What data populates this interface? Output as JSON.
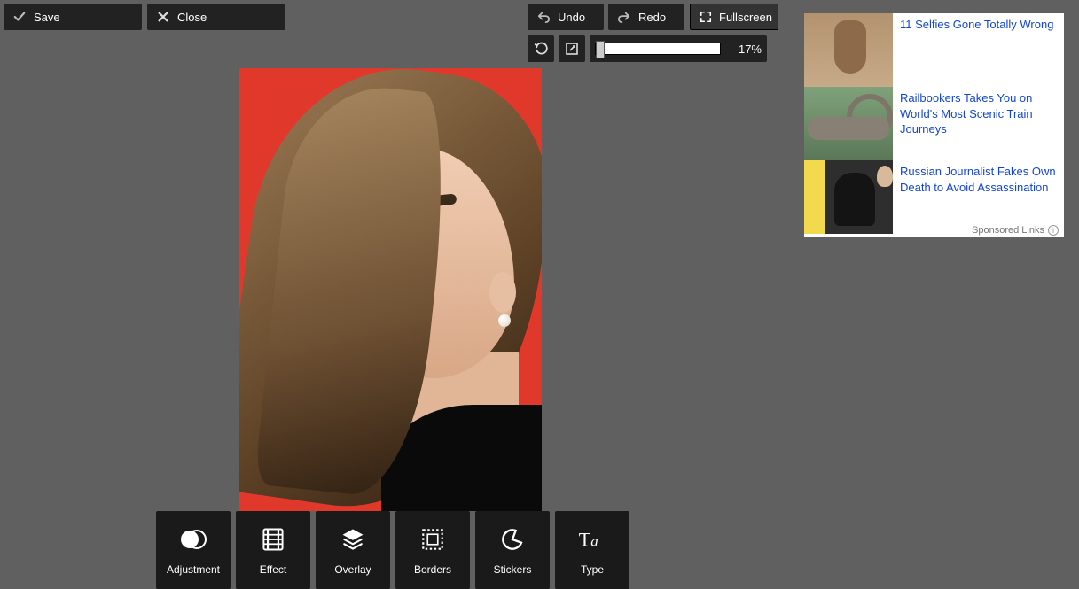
{
  "toolbar": {
    "save": "Save",
    "close": "Close",
    "undo": "Undo",
    "redo": "Redo",
    "fullscreen": "Fullscreen"
  },
  "zoom": {
    "value_text": "17%",
    "value": 17
  },
  "tools": [
    {
      "id": "adjustment",
      "label": "Adjustment"
    },
    {
      "id": "effect",
      "label": "Effect"
    },
    {
      "id": "overlay",
      "label": "Overlay"
    },
    {
      "id": "borders",
      "label": "Borders"
    },
    {
      "id": "stickers",
      "label": "Stickers"
    },
    {
      "id": "type",
      "label": "Type"
    }
  ],
  "ads": {
    "items": [
      {
        "headline": "11 Selfies Gone Totally Wrong"
      },
      {
        "headline": "Railbookers Takes You on World's Most Scenic Train Journeys"
      },
      {
        "headline": "Russian Journalist Fakes Own Death to Avoid Assassination"
      }
    ],
    "footer": "Sponsored Links"
  }
}
